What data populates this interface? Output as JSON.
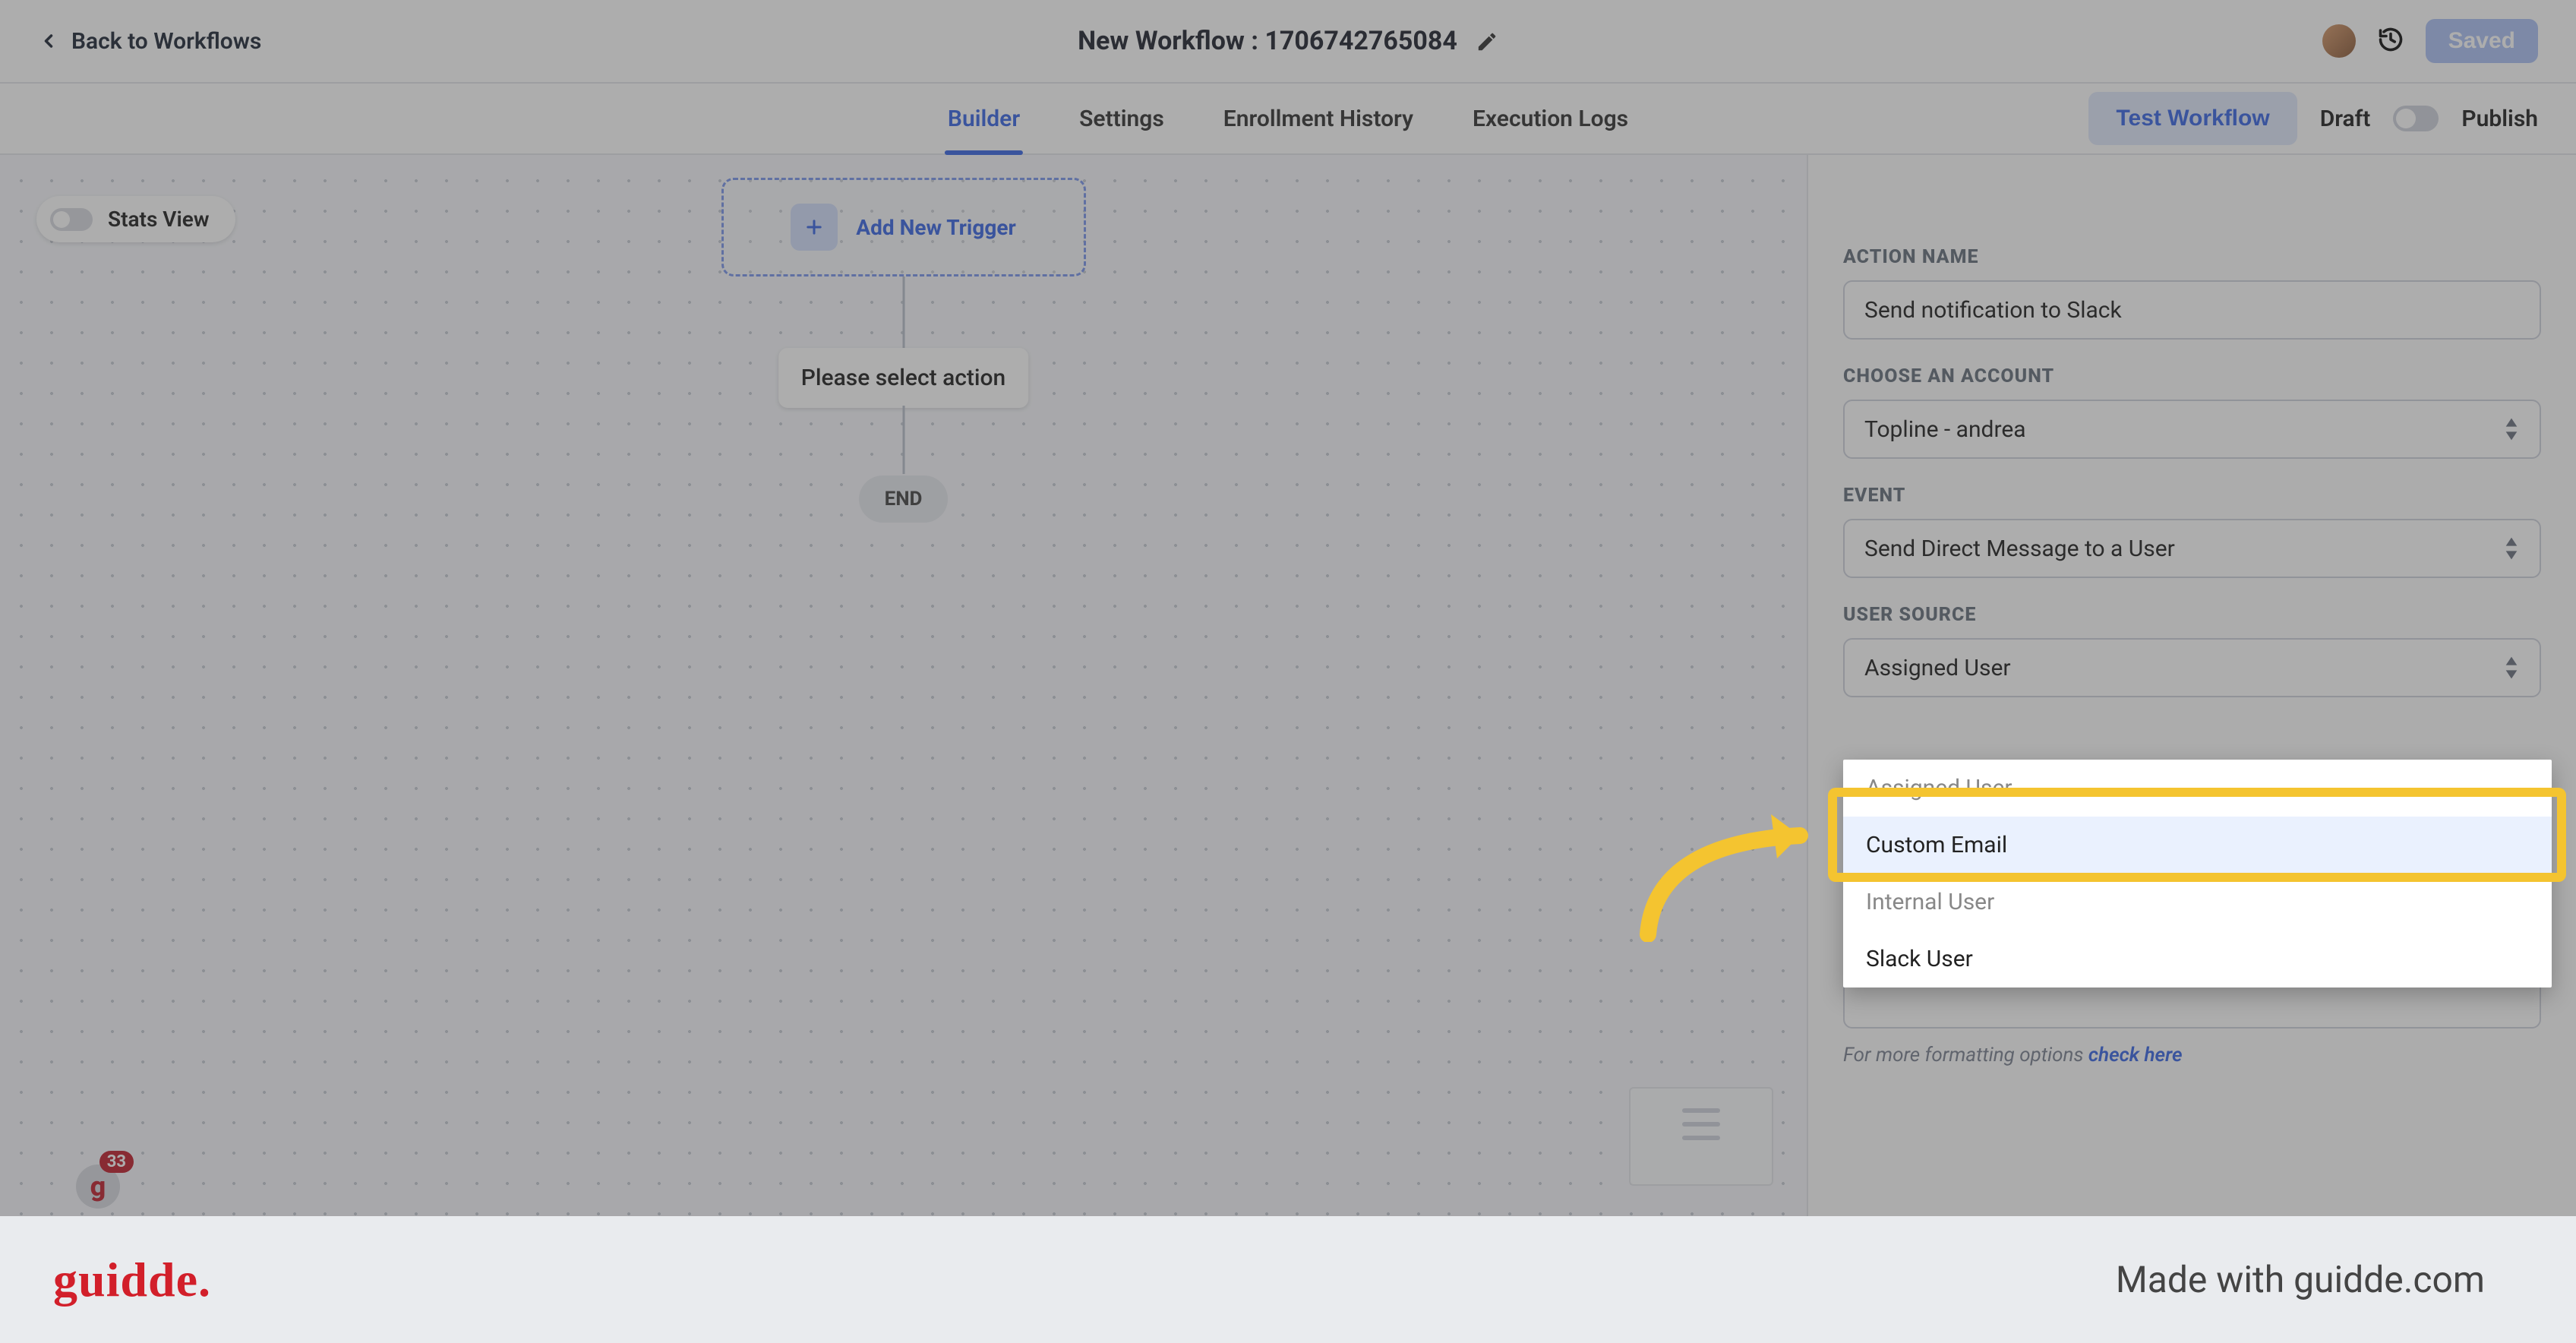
{
  "header": {
    "back_label": "Back to Workflows",
    "title": "New Workflow : 1706742765084",
    "saved_label": "Saved"
  },
  "tabs": {
    "items": [
      "Builder",
      "Settings",
      "Enrollment History",
      "Execution Logs"
    ],
    "active_index": 0,
    "test_label": "Test Workflow",
    "draft_label": "Draft",
    "publish_label": "Publish"
  },
  "canvas": {
    "stats_label": "Stats View",
    "add_trigger_label": "Add New Trigger",
    "select_action_label": "Please select action",
    "end_label": "END",
    "notification_count": "33"
  },
  "panel": {
    "action_name_label": "ACTION NAME",
    "action_name_value": "Send notification to Slack",
    "account_label": "CHOOSE AN ACCOUNT",
    "account_value": "Topline - andrea",
    "event_label": "EVENT",
    "event_value": "Send Direct Message to a User",
    "user_source_label": "USER SOURCE",
    "user_source_value": "Assigned User",
    "help_text": "For more formatting options ",
    "help_link": "check here"
  },
  "dropdown": {
    "options": [
      "Assigned User",
      "Custom Email",
      "Internal User",
      "Slack User"
    ],
    "selected_index": 1
  },
  "footer": {
    "logo": "guidde.",
    "made_with": "Made with guidde.com"
  }
}
